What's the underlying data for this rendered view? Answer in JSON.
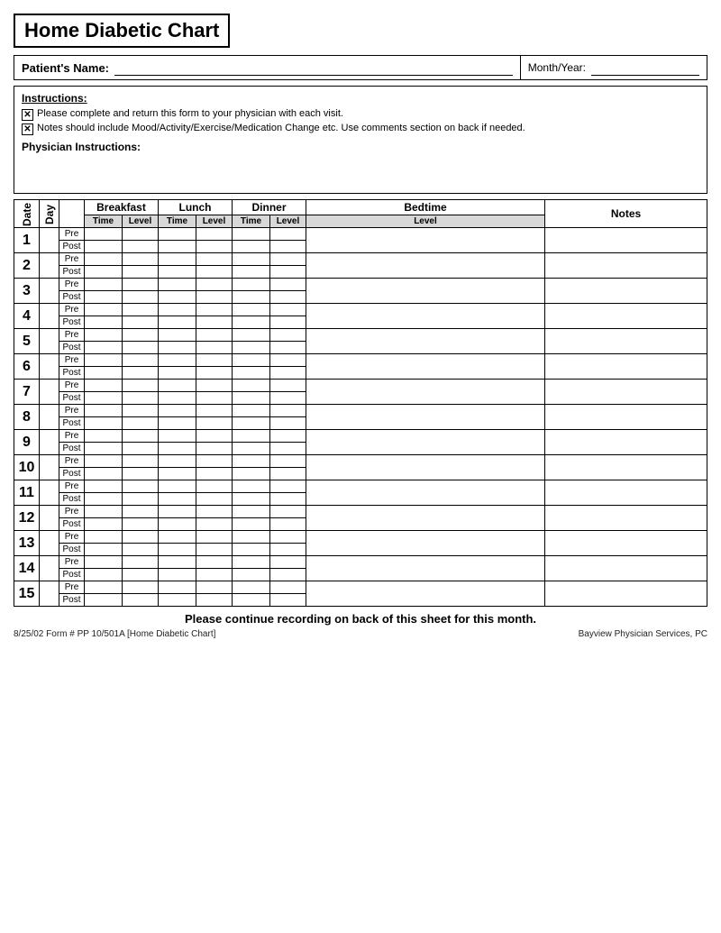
{
  "title": "Home Diabetic Chart",
  "patient_label": "Patient's Name:",
  "month_label": "Month/Year:",
  "instructions_title": "Instructions:",
  "instructions": [
    "Please complete and return this form to your physician with each visit.",
    "Notes should include Mood/Activity/Exercise/Medication Change etc.  Use comments section on back if needed."
  ],
  "physician_instructions_label": "Physician Instructions:",
  "table_headers": {
    "date": "Date",
    "day": "Day",
    "breakfast": "Breakfast",
    "lunch": "Lunch",
    "dinner": "Dinner",
    "bedtime": "Bedtime",
    "notes": "Notes"
  },
  "sub_headers": {
    "time": "Time",
    "level": "Level"
  },
  "pre": "Pre",
  "post": "Post",
  "rows": [
    1,
    2,
    3,
    4,
    5,
    6,
    7,
    8,
    9,
    10,
    11,
    12,
    13,
    14,
    15
  ],
  "footer_main": "Please continue recording on back of this sheet for this month.",
  "footer_left": "8/25/02  Form #  PP 10/501A   [Home Diabetic Chart]",
  "footer_right": "Bayview Physician Services, PC"
}
